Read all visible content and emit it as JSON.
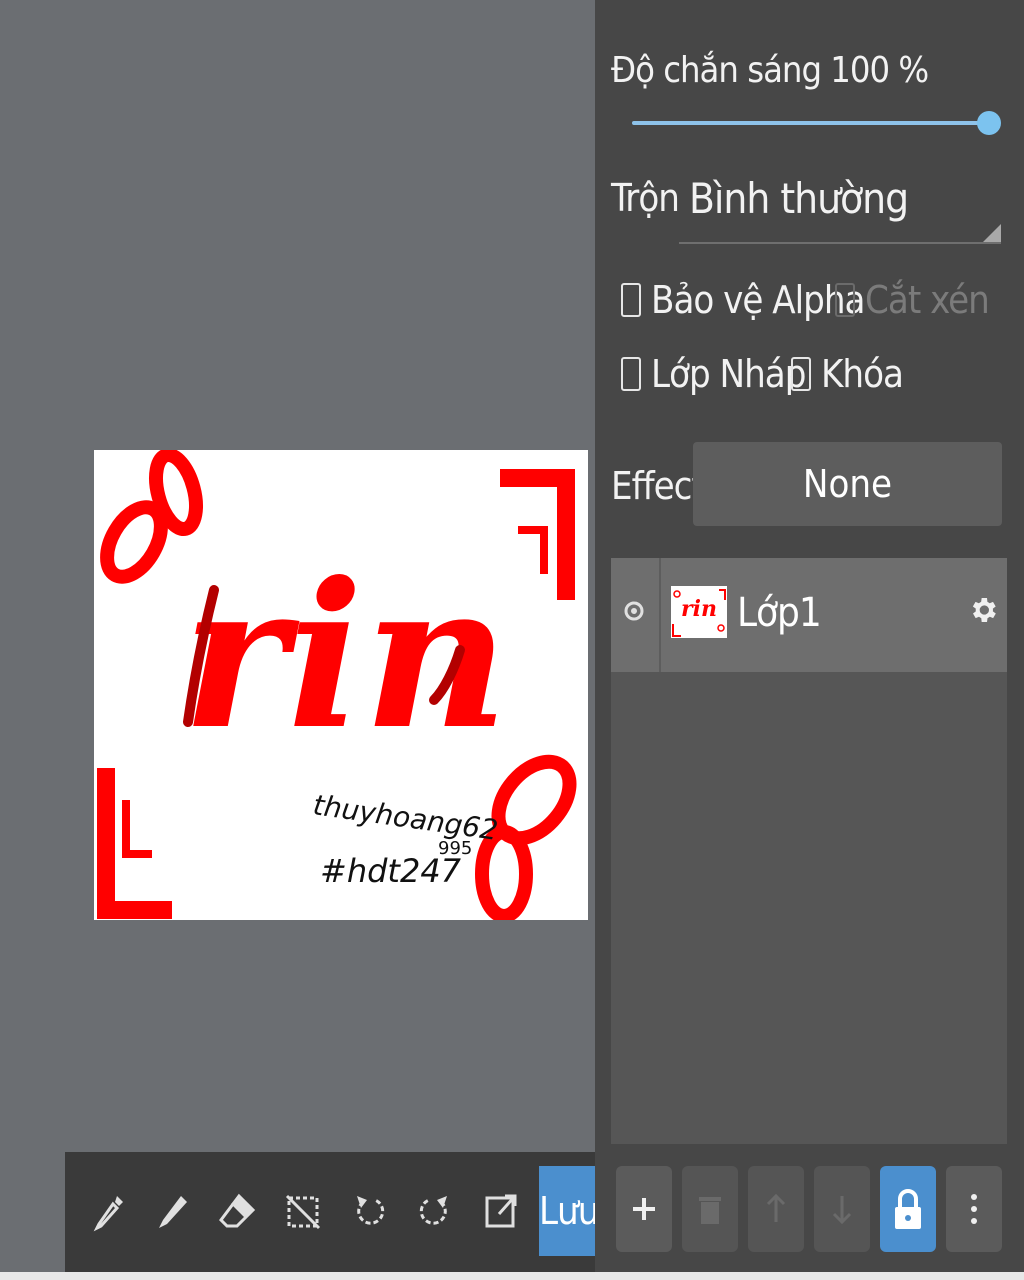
{
  "layer_props": {
    "opacity_label": "Độ chắn sáng  100  %",
    "opacity_value": 100,
    "blend_label": "Trộn",
    "blend_value": "Bình thường",
    "protect_alpha": "Bảo vệ Alpha",
    "clipping": "Cắt xén",
    "draft_layer": "Lớp Nháp",
    "lock": "Khóa",
    "effect_label": "Effect",
    "effect_value": "None"
  },
  "layers": [
    {
      "name": "Lớp1",
      "visible": true
    }
  ],
  "artwork": {
    "main_text": "rin",
    "signature_line1": "thuyhoang62",
    "signature_num": "995",
    "signature_line2": "#hdt247",
    "accent_color": "#ff0000",
    "dark_accent_color": "#b30000"
  },
  "toolbar": {
    "save_label": "Lưu",
    "icons": [
      "eyedropper-icon",
      "pen-icon",
      "eraser-icon",
      "deselect-icon",
      "undo-icon",
      "redo-icon",
      "export-icon"
    ]
  },
  "layer_buttons": {
    "icons": [
      "add-icon",
      "trash-icon",
      "arrow-up-icon",
      "arrow-down-icon",
      "lock-icon",
      "more-icon"
    ]
  },
  "colors": {
    "accent": "#4b8fce",
    "panel_bg": "#474747",
    "canvas_bg": "#6b6e72"
  }
}
